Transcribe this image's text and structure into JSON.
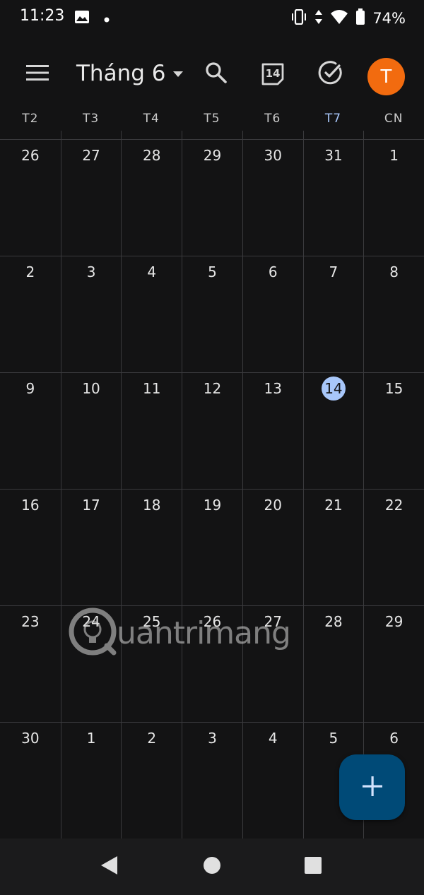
{
  "status_bar": {
    "time": "11:23",
    "battery_percent": "74%",
    "icons": [
      "image-icon",
      "dot-icon",
      "vibrate-icon",
      "data-arrows-icon",
      "wifi-icon",
      "battery-icon"
    ]
  },
  "header": {
    "menu_icon": "menu-icon",
    "month_title": "Tháng 6",
    "dropdown_icon": "dropdown-triangle-icon",
    "search_icon": "search-icon",
    "today_icon_day": "14",
    "tasks_icon": "task-check-icon",
    "avatar_initial": "T",
    "avatar_color": "#f26b0f"
  },
  "weekdays": [
    "T2",
    "T3",
    "T4",
    "T5",
    "T6",
    "T7",
    "CN"
  ],
  "highlighted_weekday_index": 5,
  "weeks": [
    [
      "26",
      "27",
      "28",
      "29",
      "30",
      "31",
      "1"
    ],
    [
      "2",
      "3",
      "4",
      "5",
      "6",
      "7",
      "8"
    ],
    [
      "9",
      "10",
      "11",
      "12",
      "13",
      "14",
      "15"
    ],
    [
      "16",
      "17",
      "18",
      "19",
      "20",
      "21",
      "22"
    ],
    [
      "23",
      "24",
      "25",
      "26",
      "27",
      "28",
      "29"
    ],
    [
      "30",
      "1",
      "2",
      "3",
      "4",
      "5",
      "6"
    ]
  ],
  "today": {
    "week": 2,
    "day": 5,
    "value": "14"
  },
  "watermark": {
    "text": "uantrimang"
  },
  "fab": {
    "icon": "plus-icon"
  },
  "nav": {
    "back": "back-triangle-icon",
    "home": "home-circle-icon",
    "recents": "recents-square-icon"
  },
  "colors": {
    "background": "#131314",
    "today_highlight": "#a8c7fa",
    "fab": "#004a77"
  }
}
